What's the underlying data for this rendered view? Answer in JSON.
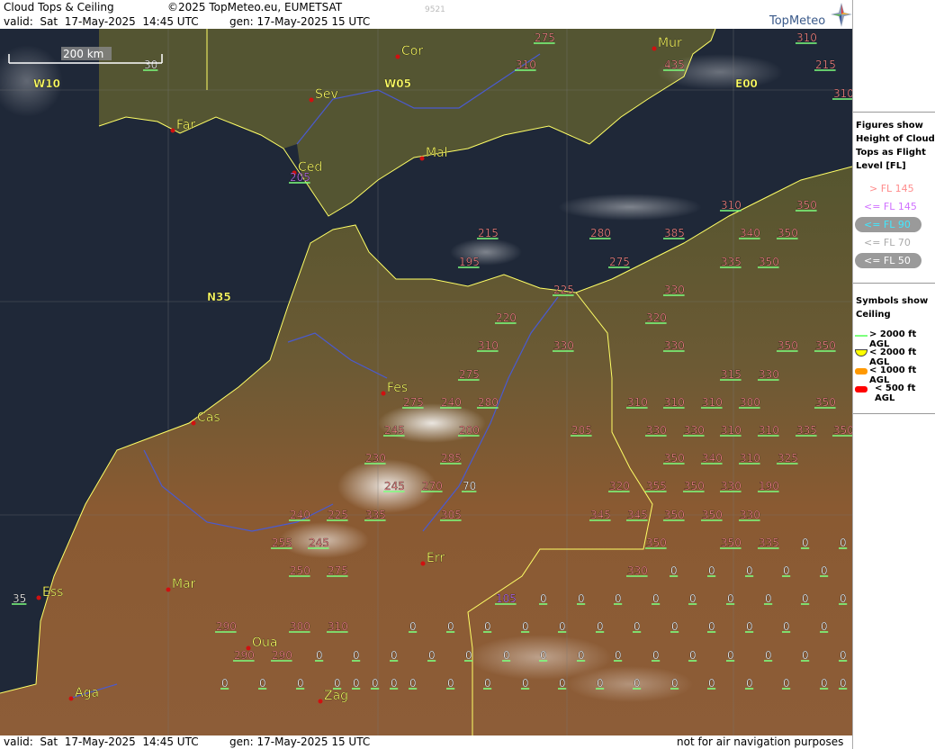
{
  "header": {
    "product": "Cloud Tops & Ceiling",
    "copyright": "©2025 TopMeteo.eu, EUMETSAT",
    "valid": "valid:  Sat  17-May-2025  14:45 UTC",
    "generated": "gen: 17-May-2025 15 UTC",
    "image_id": "9521",
    "logo_text": "TopMeteo"
  },
  "footer": {
    "valid": "valid:  Sat  17-May-2025  14:45 UTC",
    "generated": "gen: 17-May-2025 15 UTC",
    "disclaimer": "not for air navigation purposes"
  },
  "scale_bar": "200 km",
  "grid_labels": [
    "W10",
    "W05",
    "E00",
    "N35"
  ],
  "cities": [
    "Cor",
    "Mur",
    "Sev",
    "Far",
    "Mal",
    "Ced",
    "Fes",
    "Cas",
    "Err",
    "Mar",
    "Ess",
    "Oua",
    "Aga",
    "Zag"
  ],
  "cloud_tops": [
    {
      "v": "275",
      "c": "pink"
    },
    {
      "v": "310",
      "c": "pink"
    },
    {
      "v": "215",
      "c": "pink"
    },
    {
      "v": "310",
      "c": "pink"
    },
    {
      "v": "435",
      "c": "pink"
    },
    {
      "v": "310",
      "c": "pink"
    },
    {
      "v": "30",
      "c": "white"
    },
    {
      "v": "205",
      "c": "violet"
    },
    {
      "v": "310",
      "c": "pink"
    },
    {
      "v": "350",
      "c": "pink"
    },
    {
      "v": "215",
      "c": "pink"
    },
    {
      "v": "280",
      "c": "pink"
    },
    {
      "v": "385",
      "c": "pink"
    },
    {
      "v": "340",
      "c": "pink"
    },
    {
      "v": "350",
      "c": "pink"
    },
    {
      "v": "195",
      "c": "pink"
    },
    {
      "v": "275",
      "c": "pink"
    },
    {
      "v": "335",
      "c": "pink"
    },
    {
      "v": "350",
      "c": "pink"
    },
    {
      "v": "225",
      "c": "pink"
    },
    {
      "v": "330",
      "c": "pink"
    },
    {
      "v": "220",
      "c": "pink"
    },
    {
      "v": "320",
      "c": "pink"
    },
    {
      "v": "310",
      "c": "pink"
    },
    {
      "v": "330",
      "c": "pink"
    },
    {
      "v": "330",
      "c": "pink"
    },
    {
      "v": "350",
      "c": "pink"
    },
    {
      "v": "350",
      "c": "pink"
    },
    {
      "v": "275",
      "c": "pink"
    },
    {
      "v": "315",
      "c": "pink"
    },
    {
      "v": "330",
      "c": "pink"
    },
    {
      "v": "275",
      "c": "pink"
    },
    {
      "v": "240",
      "c": "pink"
    },
    {
      "v": "280",
      "c": "pink"
    },
    {
      "v": "310",
      "c": "pink"
    },
    {
      "v": "310",
      "c": "pink"
    },
    {
      "v": "310",
      "c": "pink"
    },
    {
      "v": "300",
      "c": "pink"
    },
    {
      "v": "350",
      "c": "pink"
    },
    {
      "v": "245",
      "c": "pink"
    },
    {
      "v": "200",
      "c": "pink"
    },
    {
      "v": "205",
      "c": "pink"
    },
    {
      "v": "330",
      "c": "pink"
    },
    {
      "v": "330",
      "c": "pink"
    },
    {
      "v": "310",
      "c": "pink"
    },
    {
      "v": "310",
      "c": "pink"
    },
    {
      "v": "335",
      "c": "pink"
    },
    {
      "v": "350",
      "c": "pink"
    },
    {
      "v": "230",
      "c": "pink"
    },
    {
      "v": "285",
      "c": "pink"
    },
    {
      "v": "350",
      "c": "pink"
    },
    {
      "v": "340",
      "c": "pink"
    },
    {
      "v": "310",
      "c": "pink"
    },
    {
      "v": "325",
      "c": "pink"
    },
    {
      "v": "245",
      "c": "pink"
    },
    {
      "v": "270",
      "c": "pink"
    },
    {
      "v": "70",
      "c": "white"
    },
    {
      "v": "320",
      "c": "pink"
    },
    {
      "v": "355",
      "c": "pink"
    },
    {
      "v": "350",
      "c": "pink"
    },
    {
      "v": "330",
      "c": "pink"
    },
    {
      "v": "190",
      "c": "pink"
    },
    {
      "v": "240",
      "c": "pink"
    },
    {
      "v": "225",
      "c": "pink"
    },
    {
      "v": "335",
      "c": "pink"
    },
    {
      "v": "305",
      "c": "pink"
    },
    {
      "v": "345",
      "c": "pink"
    },
    {
      "v": "345",
      "c": "pink"
    },
    {
      "v": "350",
      "c": "pink"
    },
    {
      "v": "350",
      "c": "pink"
    },
    {
      "v": "330",
      "c": "pink"
    },
    {
      "v": "255",
      "c": "pink"
    },
    {
      "v": "245",
      "c": "pink"
    },
    {
      "v": "350",
      "c": "pink"
    },
    {
      "v": "350",
      "c": "pink"
    },
    {
      "v": "335",
      "c": "pink"
    },
    {
      "v": "0",
      "c": "white"
    },
    {
      "v": "0",
      "c": "white"
    },
    {
      "v": "250",
      "c": "pink"
    },
    {
      "v": "275",
      "c": "pink"
    },
    {
      "v": "330",
      "c": "pink"
    },
    {
      "v": "0",
      "c": "white"
    },
    {
      "v": "0",
      "c": "white"
    },
    {
      "v": "0",
      "c": "white"
    },
    {
      "v": "0",
      "c": "white"
    },
    {
      "v": "0",
      "c": "white"
    },
    {
      "v": "35",
      "c": "white"
    },
    {
      "v": "105",
      "c": "violet"
    },
    {
      "v": "0",
      "c": "white"
    },
    {
      "v": "0",
      "c": "white"
    },
    {
      "v": "0",
      "c": "white"
    },
    {
      "v": "0",
      "c": "white"
    },
    {
      "v": "0",
      "c": "white"
    },
    {
      "v": "0",
      "c": "white"
    },
    {
      "v": "0",
      "c": "white"
    },
    {
      "v": "0",
      "c": "white"
    },
    {
      "v": "0",
      "c": "white"
    },
    {
      "v": "290",
      "c": "pink"
    },
    {
      "v": "300",
      "c": "pink"
    },
    {
      "v": "310",
      "c": "pink"
    },
    {
      "v": "0",
      "c": "white"
    },
    {
      "v": "0",
      "c": "white"
    },
    {
      "v": "0",
      "c": "white"
    },
    {
      "v": "0",
      "c": "white"
    },
    {
      "v": "0",
      "c": "white"
    },
    {
      "v": "0",
      "c": "white"
    },
    {
      "v": "0",
      "c": "white"
    },
    {
      "v": "0",
      "c": "white"
    },
    {
      "v": "0",
      "c": "white"
    },
    {
      "v": "0",
      "c": "white"
    },
    {
      "v": "0",
      "c": "white"
    },
    {
      "v": "0",
      "c": "white"
    },
    {
      "v": "290",
      "c": "pink"
    },
    {
      "v": "290",
      "c": "pink"
    },
    {
      "v": "0",
      "c": "white"
    },
    {
      "v": "0",
      "c": "white"
    },
    {
      "v": "0",
      "c": "white"
    },
    {
      "v": "0",
      "c": "white"
    },
    {
      "v": "0",
      "c": "white"
    },
    {
      "v": "0",
      "c": "white"
    },
    {
      "v": "0",
      "c": "white"
    },
    {
      "v": "0",
      "c": "white"
    },
    {
      "v": "0",
      "c": "white"
    },
    {
      "v": "0",
      "c": "white"
    },
    {
      "v": "0",
      "c": "white"
    },
    {
      "v": "0",
      "c": "white"
    },
    {
      "v": "0",
      "c": "white"
    },
    {
      "v": "0",
      "c": "white"
    },
    {
      "v": "0",
      "c": "white"
    },
    {
      "v": "0",
      "c": "white"
    },
    {
      "v": "0",
      "c": "white"
    },
    {
      "v": "0",
      "c": "white"
    },
    {
      "v": "0",
      "c": "white"
    },
    {
      "v": "0",
      "c": "white"
    },
    {
      "v": "0",
      "c": "white"
    },
    {
      "v": "0",
      "c": "white"
    },
    {
      "v": "0",
      "c": "white"
    },
    {
      "v": "0",
      "c": "white"
    },
    {
      "v": "0",
      "c": "white"
    },
    {
      "v": "0",
      "c": "white"
    },
    {
      "v": "0",
      "c": "white"
    },
    {
      "v": "0",
      "c": "white"
    },
    {
      "v": "0",
      "c": "white"
    },
    {
      "v": "0",
      "c": "white"
    },
    {
      "v": "0",
      "c": "white"
    },
    {
      "v": "0",
      "c": "white"
    },
    {
      "v": "0",
      "c": "white"
    },
    {
      "v": "0",
      "c": "white"
    },
    {
      "v": "0",
      "c": "white"
    },
    {
      "v": "0",
      "c": "white"
    },
    {
      "v": "0",
      "c": "white"
    },
    {
      "v": "0",
      "c": "white"
    },
    {
      "v": "0",
      "c": "white"
    },
    {
      "v": "0",
      "c": "white"
    },
    {
      "v": "0",
      "c": "white"
    },
    {
      "v": "0",
      "c": "white"
    },
    {
      "v": "0",
      "c": "white"
    },
    {
      "v": "0",
      "c": "white"
    },
    {
      "v": "0",
      "c": "white"
    },
    {
      "v": "0",
      "c": "white"
    },
    {
      "v": "0",
      "c": "white"
    },
    {
      "v": "0",
      "c": "white"
    },
    {
      "v": "0",
      "c": "white"
    },
    {
      "v": "0",
      "c": "white"
    }
  ],
  "legend": {
    "figures_title": "Figures show Height of Cloud Tops as Flight Level  [FL]",
    "fl_items": [
      {
        "label": "> FL 145",
        "color": "#ff8c8c"
      },
      {
        "label": "<= FL 145",
        "color": "#d070ff"
      },
      {
        "label": "<= FL 90",
        "color": "#40e8ff"
      },
      {
        "label": "<= FL 70",
        "color": "#aaaaaa"
      },
      {
        "label": "<= FL 50",
        "color": "#ffffff"
      }
    ],
    "symbols_title": "Symbols show Ceiling",
    "ceiling_items": [
      {
        "label": "> 2000 ft AGL",
        "color": "#7dff7d",
        "icon": "green-line-icon"
      },
      {
        "label": "< 2000 ft AGL",
        "color": "#ffff00",
        "icon": "yellow-half-disc-icon"
      },
      {
        "label": "< 1000 ft AGL",
        "color": "#ff9900",
        "icon": "orange-bar-icon"
      },
      {
        "label": "< 500 ft AGL",
        "color": "#ff0000",
        "icon": "red-bar-icon"
      }
    ]
  },
  "colors": {
    "sea": "#1e2738",
    "land_north": "#5b5632",
    "land_south": "#8a5b34",
    "pink": "#ff8c8c",
    "violet": "#c878ff",
    "white": "#ffffff",
    "city_label": "#ffff66",
    "grid_label": "#ffff66",
    "border": "#ffff66",
    "river": "#4a5ad0",
    "ceiling_ok": "#7dff7d"
  }
}
